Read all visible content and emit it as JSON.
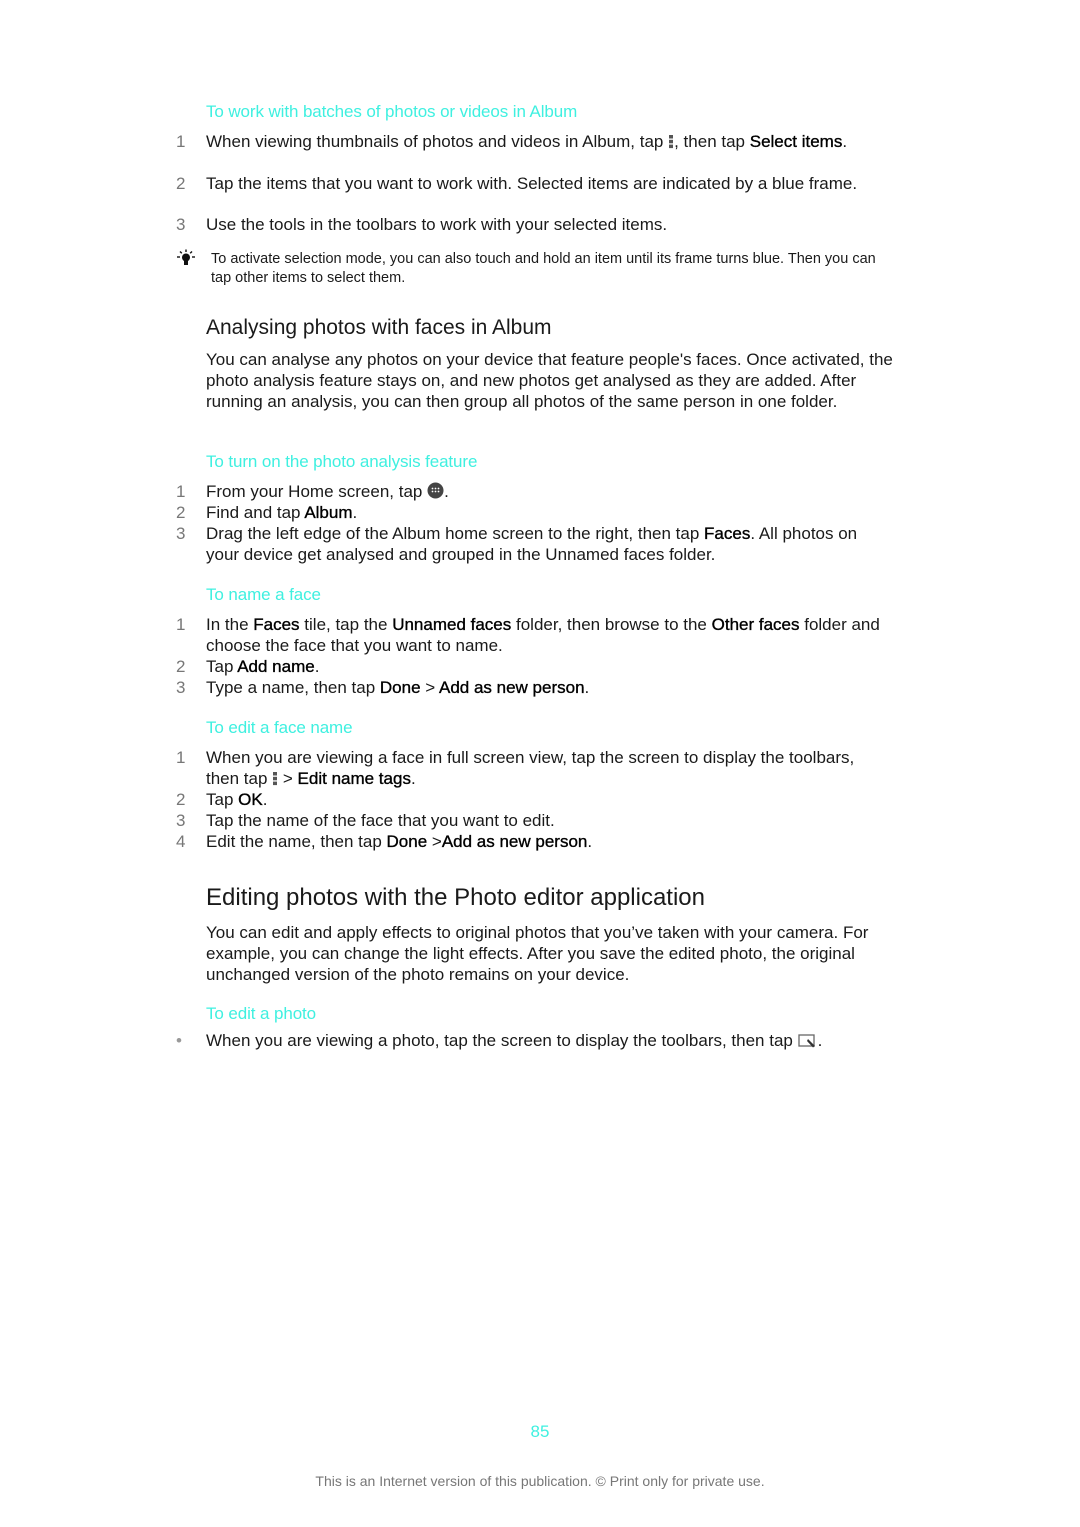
{
  "section_batches": {
    "title": "To work with batches of photos or videos in Album",
    "steps": [
      {
        "num": "1",
        "before": "When viewing thumbnails of photos and videos in Album, tap ",
        "icon": "more-vert-icon",
        "after": ", then tap ",
        "bold": "Select items",
        "end": "."
      },
      {
        "num": "2",
        "text": "Tap the items that you want to work with. Selected items are indicated by a blue frame."
      },
      {
        "num": "3",
        "text": "Use the tools in the toolbars to work with your selected items."
      }
    ],
    "tip": {
      "icon": "lightbulb-icon",
      "text": "To activate selection mode, you can also touch and hold an item until its frame turns blue. Then you can tap other items to select them."
    }
  },
  "section_faces": {
    "heading": "Analysing photos with faces in Album",
    "intro": "You can analyse any photos on your device that feature people's faces. Once activated, the photo analysis feature stays on, and new photos get analysed as they are added. After running an analysis, you can then group all photos of the same person in one folder.",
    "turn_on": {
      "title": "To turn on the photo analysis feature",
      "step1": {
        "num": "1",
        "before": "From your Home screen, tap ",
        "icon": "app-drawer-icon",
        "end": "."
      },
      "step2": {
        "num": "2",
        "before": "Find and tap ",
        "bold": "Album",
        "end": "."
      },
      "step3": {
        "num": "3",
        "before": "Drag the left edge of the Album home screen to the right, then tap ",
        "bold": "Faces",
        "end": ". All photos on your device get analysed and grouped in the Unnamed faces folder."
      }
    },
    "name_face": {
      "title": "To name a face",
      "step1": {
        "num": "1",
        "p1": "In the ",
        "b1": "Faces",
        "p2": " tile, tap the ",
        "b2": "Unnamed faces",
        "p3": " folder, then browse to the ",
        "b3": "Other faces",
        "p4": " folder and choose the face that you want to name."
      },
      "step2": {
        "num": "2",
        "before": "Tap ",
        "bold": "Add name",
        "end": "."
      },
      "step3": {
        "num": "3",
        "before": "Type a name, then tap ",
        "b1": "Done",
        "sep": " > ",
        "b2": "Add as new person",
        "end": "."
      }
    },
    "edit_face": {
      "title": "To edit a face name",
      "step1": {
        "num": "1",
        "before": "When you are viewing a face in full screen view, tap the screen to display the toolbars, then tap ",
        "icon": "more-vert-icon",
        "sep": " > ",
        "bold": "Edit name tags",
        "end": "."
      },
      "step2": {
        "num": "2",
        "before": "Tap ",
        "bold": "OK",
        "end": "."
      },
      "step3": {
        "num": "3",
        "text": "Tap the name of the face that you want to edit."
      },
      "step4": {
        "num": "4",
        "before": "Edit the name, then tap ",
        "b1": "Done",
        "sep": " >",
        "b2": "Add as new person",
        "end": "."
      }
    }
  },
  "section_editor": {
    "heading": "Editing photos with the Photo editor application",
    "intro": "You can edit and apply effects to original photos that you’ve taken with your camera. For example, you can change the light effects. After you save the edited photo, the original unchanged version of the photo remains on your device.",
    "edit_photo": {
      "title": "To edit a photo",
      "bullet": "•",
      "text": "When you are viewing a photo, tap the screen to display the toolbars, then tap ",
      "icon": "edit-photo-icon",
      "end": "."
    }
  },
  "footer": {
    "page_number": "85",
    "notice": "This is an Internet version of this publication. © Print only for private use."
  },
  "colors": {
    "accent": "#3ff0e0",
    "text": "#1a1a1a",
    "muted": "#777777"
  }
}
